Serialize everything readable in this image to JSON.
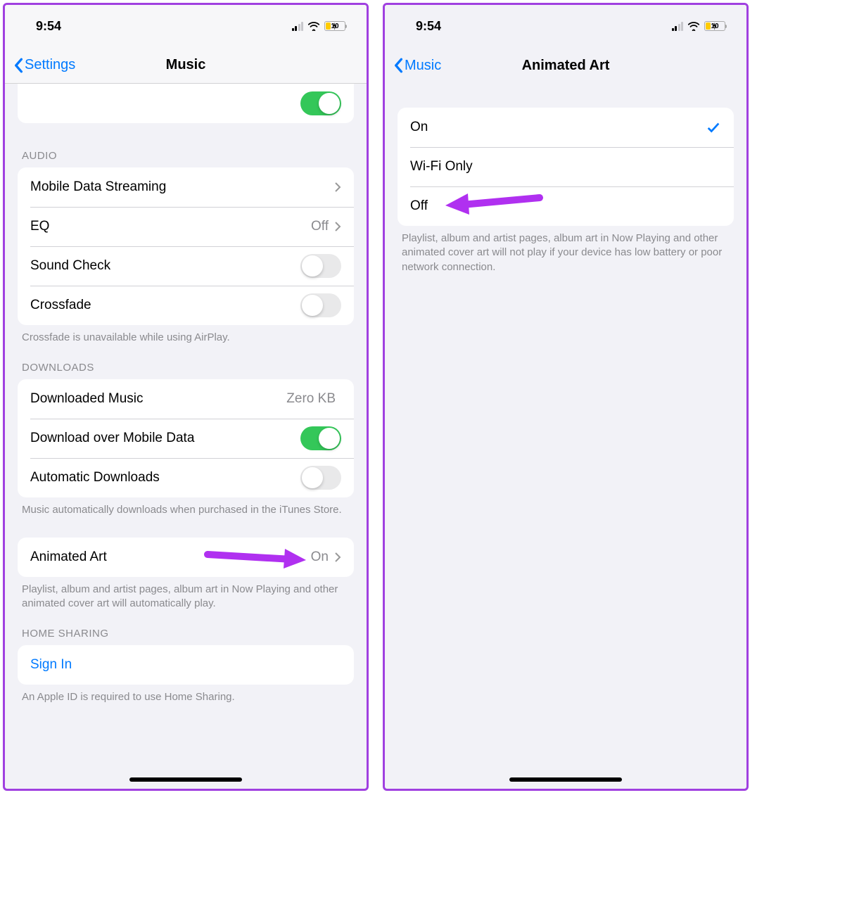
{
  "status": {
    "time": "9:54",
    "battery": "10"
  },
  "left": {
    "back": "Settings",
    "title": "Music",
    "audio_header": "AUDIO",
    "mobile_data_streaming": "Mobile Data Streaming",
    "eq_label": "EQ",
    "eq_value": "Off",
    "sound_check": "Sound Check",
    "crossfade": "Crossfade",
    "crossfade_footer": "Crossfade is unavailable while using AirPlay.",
    "downloads_header": "DOWNLOADS",
    "downloaded_music": "Downloaded Music",
    "downloaded_music_value": "Zero KB",
    "download_over_mobile": "Download over Mobile Data",
    "automatic_downloads": "Automatic Downloads",
    "downloads_footer": "Music automatically downloads when purchased in the iTunes Store.",
    "animated_art": "Animated Art",
    "animated_art_value": "On",
    "animated_art_footer": "Playlist, album and artist pages, album art in Now Playing and other animated cover art will automatically play.",
    "home_sharing_header": "HOME SHARING",
    "sign_in": "Sign In",
    "home_sharing_footer": "An Apple ID is required to use Home Sharing."
  },
  "right": {
    "back": "Music",
    "title": "Animated Art",
    "on": "On",
    "wifi_only": "Wi-Fi Only",
    "off": "Off",
    "footer": "Playlist, album and artist pages, album art in Now Playing and other animated cover art will not play if your device has low battery or poor network connection."
  }
}
